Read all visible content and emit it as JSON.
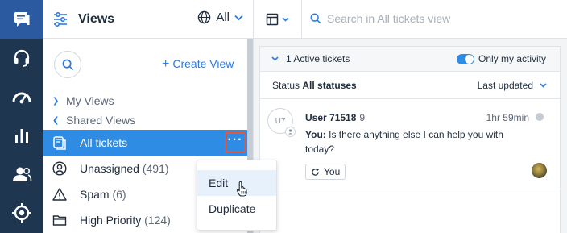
{
  "rail": {
    "items": [
      "inbox-icon",
      "headset-icon",
      "dashboard-icon",
      "reports-icon",
      "contacts-icon",
      "settings-icon"
    ]
  },
  "views_panel": {
    "title": "Views",
    "filter_value": "All",
    "create_view_label": "Create View",
    "groups": {
      "my_views": "My Views",
      "shared_views": "Shared Views"
    },
    "items": [
      {
        "label": "All tickets",
        "count": "",
        "active": true,
        "icon": "tickets-icon"
      },
      {
        "label": "Unassigned",
        "count": "(491)",
        "icon": "user-icon"
      },
      {
        "label": "Spam",
        "count": "(6)",
        "icon": "warning-icon"
      },
      {
        "label": "High Priority",
        "count": "(124)",
        "icon": "folder-icon"
      }
    ],
    "more_button": "···"
  },
  "context_menu": {
    "items": [
      "Edit",
      "Duplicate"
    ]
  },
  "topbar": {
    "search_placeholder": "Search in All tickets view"
  },
  "tickets": {
    "active_label": "1 Active tickets",
    "only_my_activity": "Only my activity",
    "status_label": "Status",
    "status_value": "All statuses",
    "sort_label": "Last updated",
    "list": [
      {
        "avatar_initials": "U7",
        "user": "User 71518",
        "count": "9",
        "time": "1hr 59min",
        "message_prefix": "You:",
        "message": "Is there anything else I can help you with today?",
        "assignee_chip": "You"
      }
    ]
  },
  "colors": {
    "rail_bg": "#1e3650",
    "rail_active": "#2c5aa0",
    "accent": "#2f8ce5",
    "highlight_border": "#e8563a"
  }
}
